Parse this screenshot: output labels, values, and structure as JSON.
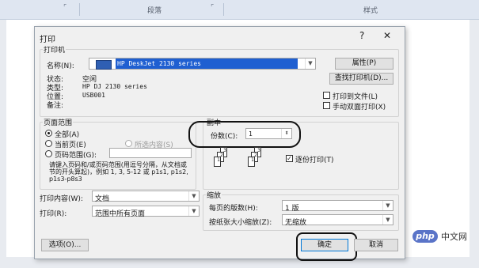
{
  "ribbon": {
    "group_paragraph": "段落",
    "group_styles": "样式"
  },
  "dialog": {
    "title": "打印",
    "help_icon": "?",
    "close_icon": "✕",
    "printer": {
      "group": "打印机",
      "name_label": "名称(N):",
      "name_value": "HP DeskJet 2130 series",
      "properties_button": "属性(P)",
      "find_printer_button": "查找打印机(D)...",
      "print_to_file": "打印到文件(L)",
      "manual_duplex": "手动双面打印(X)",
      "status_label": "状态:",
      "status_value": "空闲",
      "type_label": "类型:",
      "type_value": "HP DJ 2130 series",
      "where_label": "位置:",
      "where_value": "USB001",
      "comment_label": "备注:"
    },
    "page_range": {
      "group": "页面范围",
      "all": "全部(A)",
      "current": "当前页(E)",
      "selection": "所选内容(S)",
      "pages": "页码范围(G):",
      "hint": "请键入页码和/或页码范围(用逗号分隔，从文档或节的开头算起)，例如  1, 3, 5-12 或 p1s1, p1s2, p1s3-p8s3"
    },
    "copies": {
      "group": "副本",
      "count_label": "份数(C):",
      "count_value": "1",
      "collate": "逐份打印(T)"
    },
    "print_what_label": "打印内容(W):",
    "print_what_value": "文档",
    "print_label": "打印(R):",
    "print_value": "范围中所有页面",
    "zoom": {
      "group": "缩放",
      "pages_per_sheet_label": "每页的版数(H):",
      "pages_per_sheet_value": "1 版",
      "scale_label": "按纸张大小缩放(Z):",
      "scale_value": "无缩放"
    },
    "options_button": "选项(O)...",
    "ok_button": "确定",
    "cancel_button": "取消"
  },
  "watermark": {
    "badge": "php",
    "text": "中文网"
  }
}
